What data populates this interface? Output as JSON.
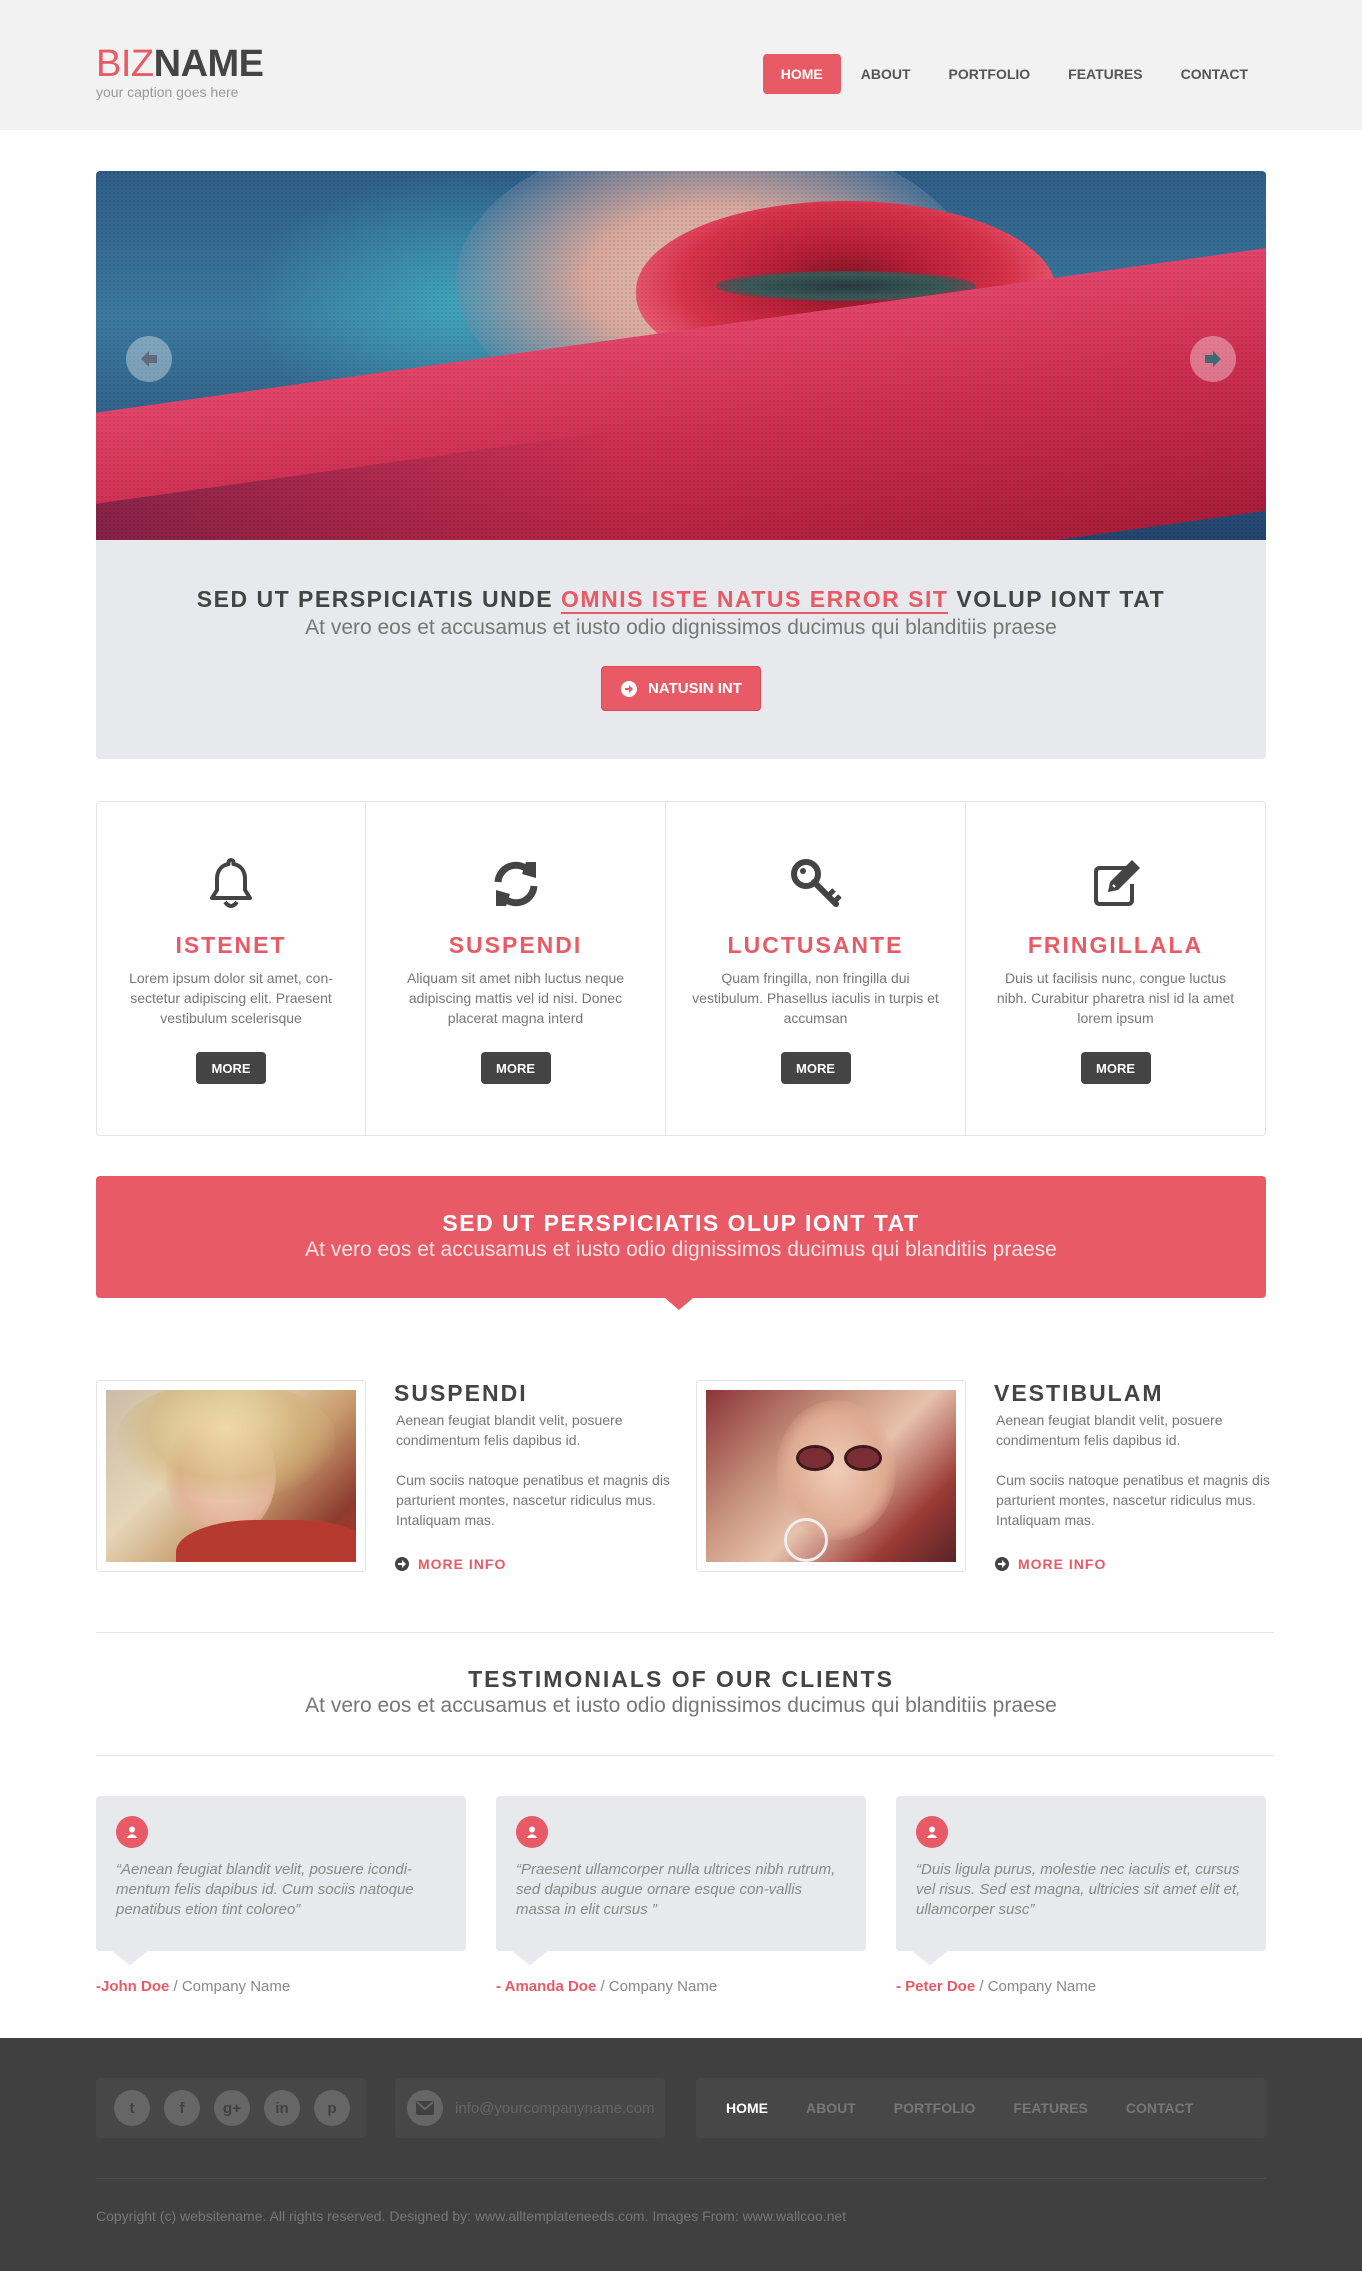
{
  "colors": {
    "accent": "#e85a66",
    "dark": "#444444",
    "panel": "#e7e9ec",
    "footer": "#404040"
  },
  "header": {
    "logo_part1": "BIZ",
    "logo_part2": "NAME",
    "caption": "your caption goes here",
    "nav": [
      "HOME",
      "ABOUT",
      "PORTFOLIO",
      "FEATURES",
      "CONTACT"
    ],
    "active_nav": "HOME"
  },
  "slider": {
    "prev_icon": "arrow-left-icon",
    "next_icon": "arrow-right-icon"
  },
  "cta": {
    "title_before": "SED UT PERSPICIATIS UNDE ",
    "title_highlight": "OMNIS ISTE NATUS ERROR SIT",
    "title_after": " VOLUP IONT TAT",
    "subtitle": "At vero eos et accusamus et iusto odio dignissimos ducimus qui blanditiis praese",
    "button_label": "NATUSIN INT"
  },
  "features": [
    {
      "icon": "bell-icon",
      "title": "ISTENET",
      "text": "Lorem ipsum dolor sit amet, con-sectetur adipiscing elit. Praesent vestibulum scelerisque",
      "button": "MORE"
    },
    {
      "icon": "refresh-icon",
      "title": "SUSPENDI",
      "text": "Aliquam sit amet nibh luctus neque adipiscing mattis vel id nisi. Donec placerat magna interd",
      "button": "MORE"
    },
    {
      "icon": "key-icon",
      "title": "LUCTUSANTE",
      "text": "Quam fringilla, non fringilla dui vestibulum. Phasellus iaculis in turpis et accumsan",
      "button": "MORE"
    },
    {
      "icon": "edit-icon",
      "title": "FRINGILLALA",
      "text": "Duis ut facilisis nunc, congue luctus nibh. Curabitur pharetra nisl id la amet lorem ipsum",
      "button": "MORE"
    }
  ],
  "banner": {
    "title": "SED UT PERSPICIATIS OLUP IONT TAT",
    "subtitle": "At vero eos et accusamus et iusto odio dignissimos ducimus qui blanditiis praese"
  },
  "profiles": [
    {
      "name": "SUSPENDI",
      "p1": "Aenean feugiat blandit velit, posuere condimentum felis dapibus id.",
      "p2": "Cum sociis natoque penatibus et magnis dis parturient montes, nascetur ridiculus mus. Intaliquam mas.",
      "more": "MORE INFO"
    },
    {
      "name": "VESTIBULAM",
      "p1": "Aenean feugiat blandit velit, posuere condimentum felis dapibus id.",
      "p2": "Cum sociis natoque penatibus et magnis dis parturient montes, nascetur ridiculus mus. Intaliquam mas.",
      "more": "MORE INFO"
    }
  ],
  "testimonials": {
    "title": "TESTIMONIALS OF OUR CLIENTS",
    "subtitle": "At vero eos et accusamus et iusto odio dignissimos ducimus qui blanditiis praese",
    "items": [
      {
        "quote": "“Aenean feugiat blandit velit, posuere icondi-mentum felis dapibus id. Cum sociis natoque penatibus etion tint coloreo”",
        "name": "-John Doe",
        "company": " / Company Name"
      },
      {
        "quote": "“Praesent ullamcorper nulla ultrices nibh rutrum, sed dapibus augue ornare esque con-vallis massa in elit cursus ”",
        "name": "- Amanda Doe",
        "company": " / Company Name"
      },
      {
        "quote": "“Duis ligula purus, molestie nec iaculis et, cursus vel risus. Sed est magna, ultricies sit amet elit et, ullamcorper susc”",
        "name": "- Peter Doe",
        "company": " / Company Name"
      }
    ]
  },
  "footer": {
    "social": [
      "twitter-icon",
      "facebook-icon",
      "google-plus-icon",
      "linkedin-icon",
      "pinterest-icon"
    ],
    "social_glyphs": [
      "t",
      "f",
      "g+",
      "in",
      "p"
    ],
    "email": "info@yourcompanyname.com",
    "nav": [
      "HOME",
      "ABOUT",
      "PORTFOLIO",
      "FEATURES",
      "CONTACT"
    ],
    "copyright": "Copyright (c) websitename. All rights reserved. Designed by: www.alltemplateneeds.com.  Images From: www.wallcoo.net"
  }
}
